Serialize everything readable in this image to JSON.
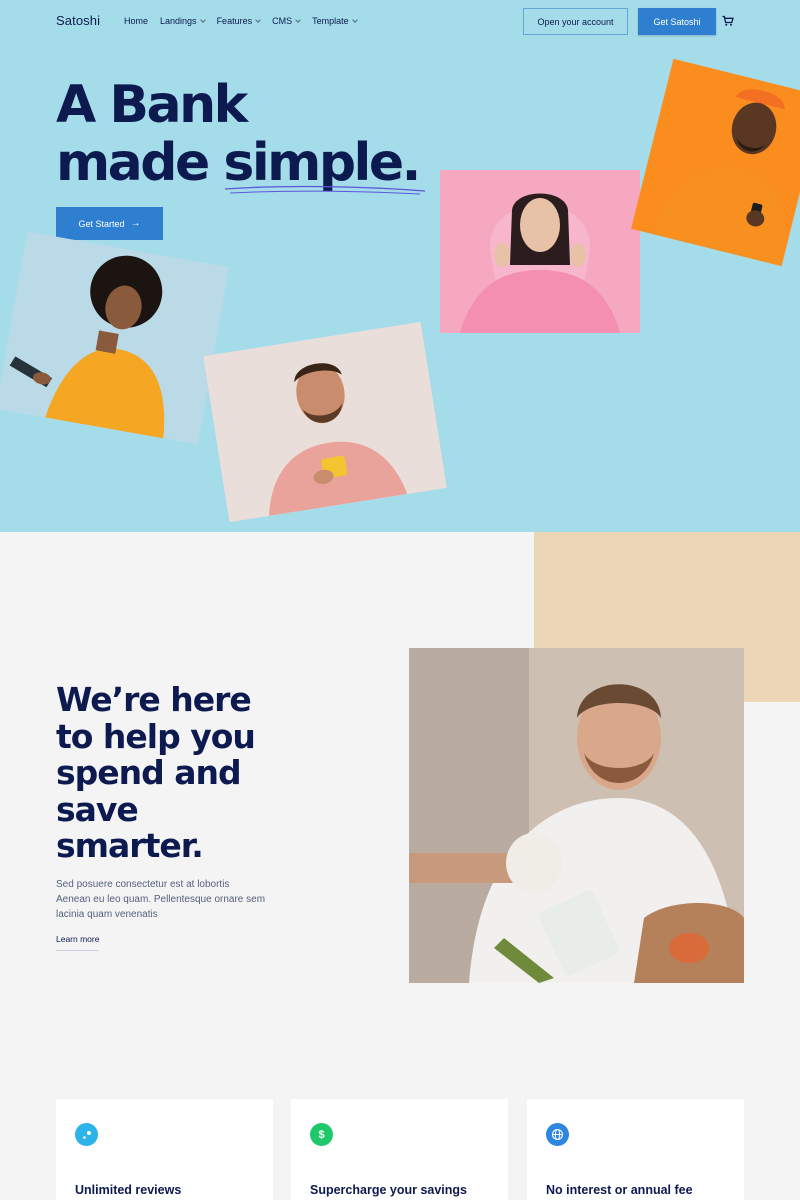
{
  "nav": {
    "brand": "Satoshi",
    "menu": [
      {
        "label": "Home",
        "dropdown": false
      },
      {
        "label": "Landings",
        "dropdown": true
      },
      {
        "label": "Features",
        "dropdown": true
      },
      {
        "label": "CMS",
        "dropdown": true
      },
      {
        "label": "Template",
        "dropdown": true
      }
    ],
    "open_account_label": "Open your account",
    "get_satoshi_label": "Get Satoshi",
    "cart_icon": "cart-icon"
  },
  "hero": {
    "title_line1": "A Bank",
    "title_line2_a": "made ",
    "title_line2_b": "simple.",
    "cta_label": "Get Started",
    "cta_icon": "arrow-right-icon",
    "background_color": "#a5dcea"
  },
  "feature": {
    "title_lines": [
      "We’re here",
      "to help you",
      "spend and",
      "save",
      "smarter."
    ],
    "description": "Sed posuere consectetur est at lobortis Aenean eu leo quam. Pellentesque ornare sem lacinia quam venenatis",
    "link_label": "Learn more"
  },
  "cards": [
    {
      "title": "Unlimited reviews",
      "icon": "sparkle-icon",
      "color": "#2bb3ea"
    },
    {
      "title": "Supercharge your savings",
      "icon": "dollar-icon",
      "color": "#1fc86b"
    },
    {
      "title": "No interest or annual fee",
      "icon": "globe-icon",
      "color": "#2e86de"
    }
  ],
  "colors": {
    "accent": "#2f7fd0",
    "heading": "#0c1a4f",
    "beige": "#ecd6b8"
  }
}
